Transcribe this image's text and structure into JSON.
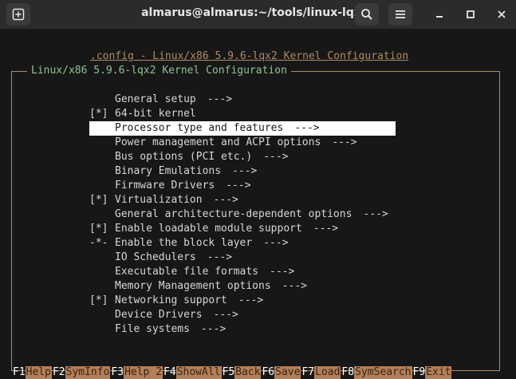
{
  "window": {
    "title": "almarus@almarus:~/tools/linux-lqx",
    "new_tab_icon": "new-tab-icon",
    "search_icon": "search-icon",
    "menu_icon": "hamburger-menu-icon",
    "minimize_icon": "minimize-icon",
    "maximize_icon": "maximize-icon",
    "close_icon": "close-icon"
  },
  "terminal": {
    "header": ".config - Linux/x86 5.9.6-lqx2 Kernel Configuration",
    "frame_title": "Linux/x86 5.9.6-lqx2 Kernel Configuration",
    "items": [
      {
        "mark": "",
        "label": "General setup",
        "arrow": "--->"
      },
      {
        "mark": "[*]",
        "label": "64-bit kernel",
        "arrow": ""
      },
      {
        "mark": "",
        "label": "Processor type and features",
        "arrow": "--->",
        "selected": true
      },
      {
        "mark": "",
        "label": "Power management and ACPI options",
        "arrow": "--->"
      },
      {
        "mark": "",
        "label": "Bus options (PCI etc.)",
        "arrow": "--->"
      },
      {
        "mark": "",
        "label": "Binary Emulations",
        "arrow": "--->"
      },
      {
        "mark": "",
        "label": "Firmware Drivers",
        "arrow": "--->"
      },
      {
        "mark": "[*]",
        "label": "Virtualization",
        "arrow": "--->"
      },
      {
        "mark": "",
        "label": "General architecture-dependent options",
        "arrow": "--->"
      },
      {
        "mark": "[*]",
        "label": "Enable loadable module support",
        "arrow": "--->"
      },
      {
        "mark": "-*-",
        "label": "Enable the block layer",
        "arrow": "--->"
      },
      {
        "mark": "",
        "label": "IO Schedulers",
        "arrow": "--->"
      },
      {
        "mark": "",
        "label": "Executable file formats",
        "arrow": "--->"
      },
      {
        "mark": "",
        "label": "Memory Management options",
        "arrow": "--->"
      },
      {
        "mark": "[*]",
        "label": "Networking support",
        "arrow": "--->"
      },
      {
        "mark": "",
        "label": "Device Drivers",
        "arrow": "--->"
      },
      {
        "mark": "",
        "label": "File systems",
        "arrow": "--->"
      }
    ],
    "function_keys": [
      {
        "key": "F1",
        "label": "Help"
      },
      {
        "key": "F2",
        "label": "SymInfo"
      },
      {
        "key": "F3",
        "label": "Help 2"
      },
      {
        "key": "F4",
        "label": "ShowAll"
      },
      {
        "key": "F5",
        "label": "Back"
      },
      {
        "key": "F6",
        "label": "Save"
      },
      {
        "key": "F7",
        "label": "Load"
      },
      {
        "key": "F8",
        "label": "SymSearch"
      },
      {
        "key": "F9",
        "label": "Exit"
      }
    ]
  },
  "colors": {
    "header": "#ae8a63",
    "frame_title": "#8fc28f",
    "key_label_bg": "#b37f58"
  }
}
